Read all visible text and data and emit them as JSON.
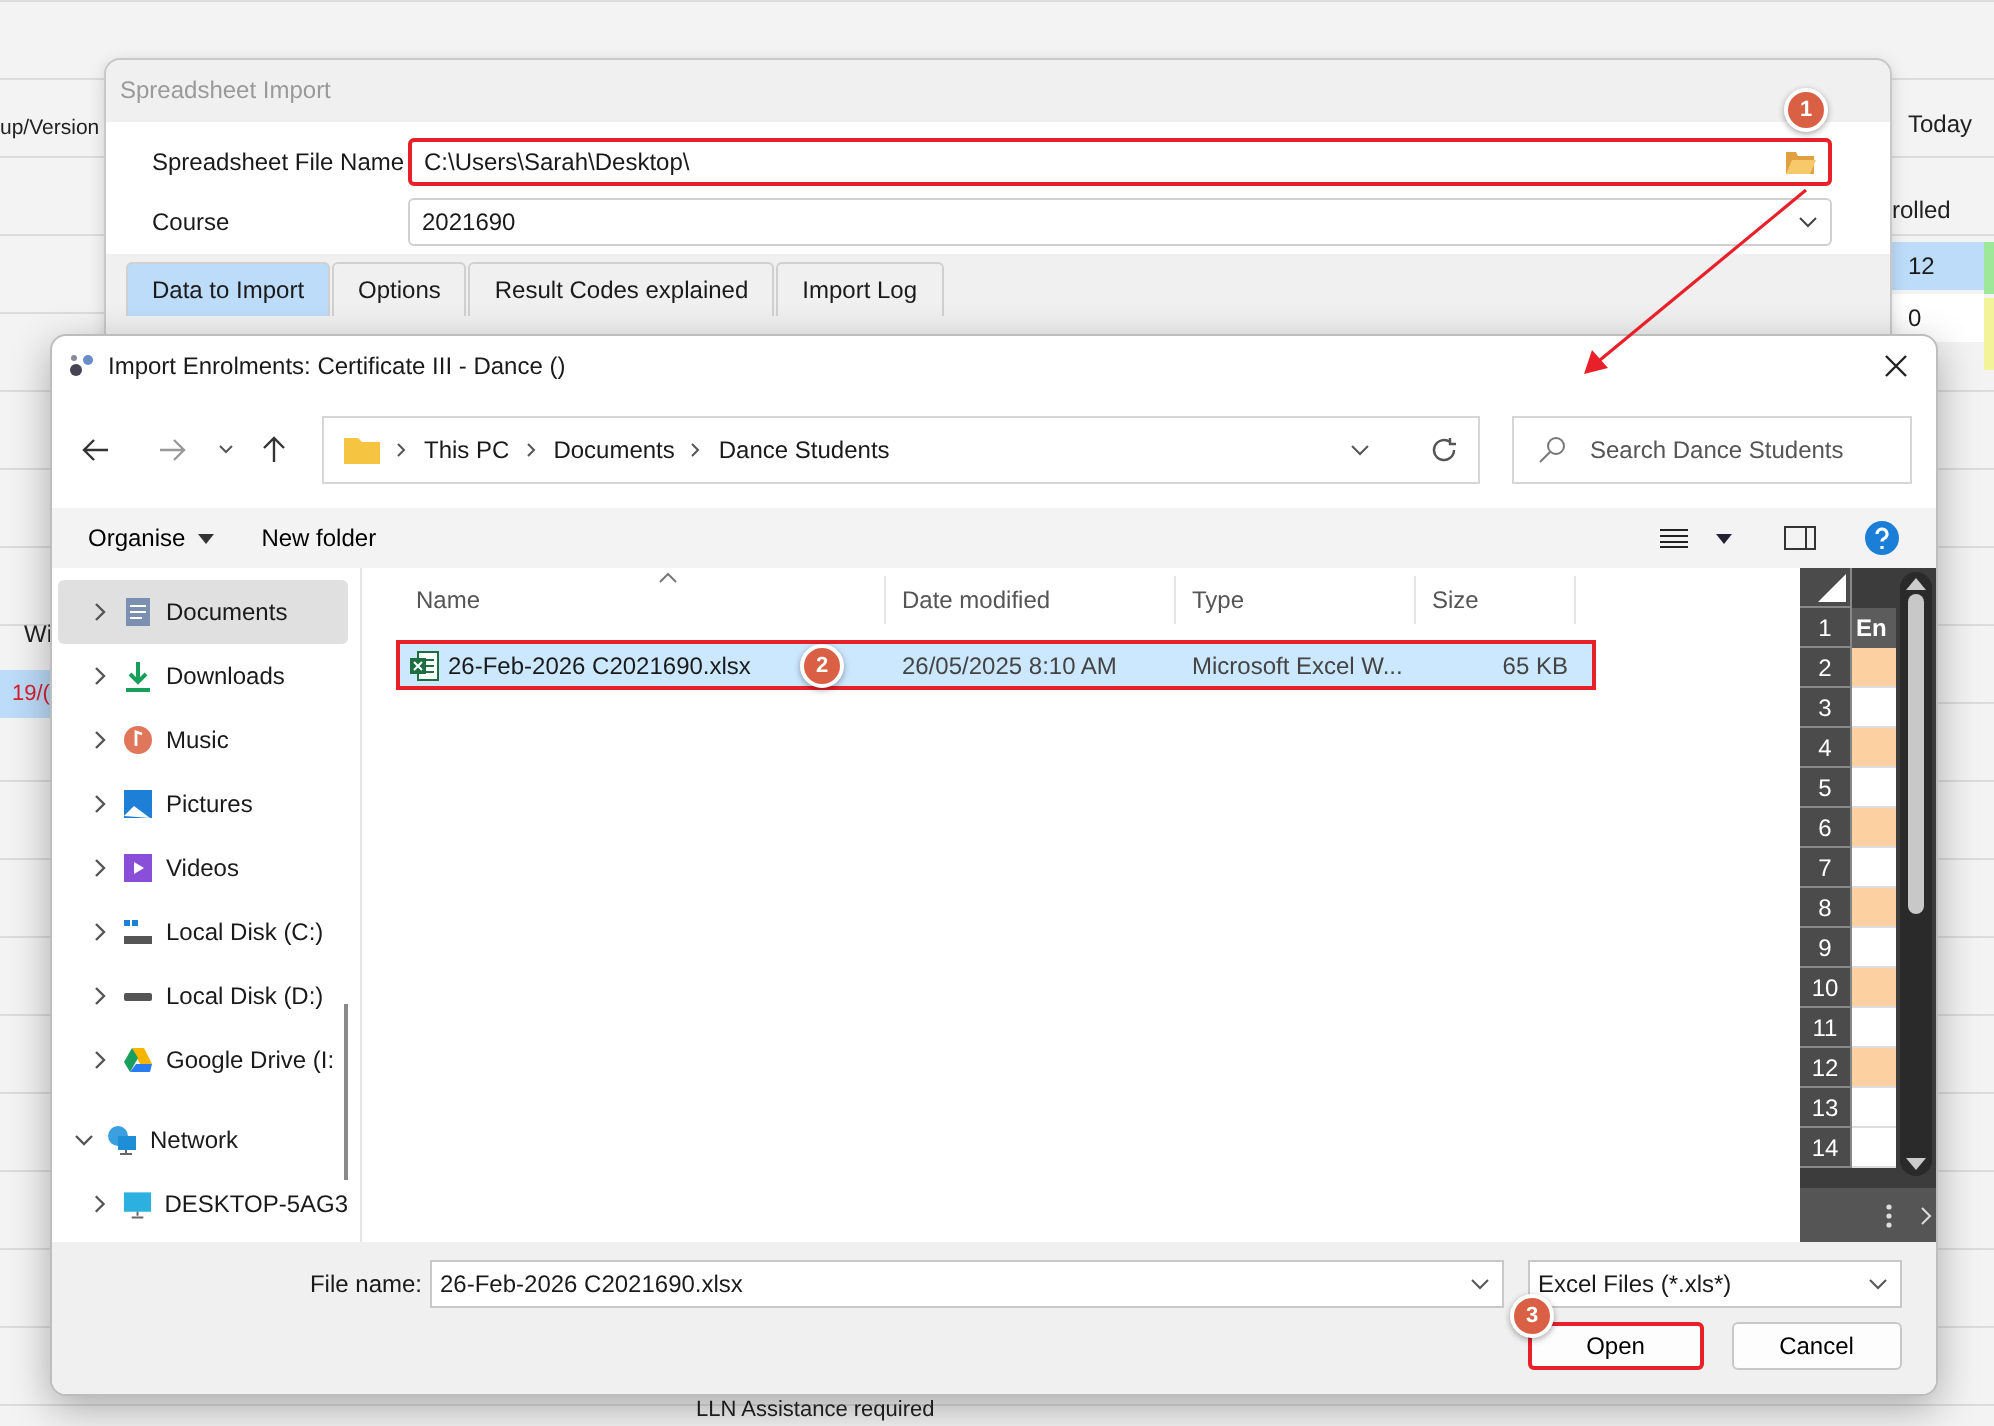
{
  "background_app": {
    "left_header": "up/Version",
    "right_header": "Today",
    "count_header": "rolled",
    "count_cells": [
      {
        "value": "12",
        "selected": true
      },
      {
        "value": "0",
        "selected": false
      }
    ],
    "side_header": "Wi",
    "side_cell": "19/(",
    "bottom_label": "LLN Assistance required"
  },
  "import_window": {
    "title": "Spreadsheet Import",
    "fields": [
      {
        "kind": "file",
        "label": "Spreadsheet File Name",
        "value": "C:\\Users\\Sarah\\Desktop\\",
        "highlighted": true,
        "badge": "1"
      },
      {
        "kind": "dropdown",
        "label": "Course",
        "value": "2021690",
        "highlighted": false
      }
    ],
    "tabs": [
      {
        "label": "Data to Import",
        "selected": true
      },
      {
        "label": "Options",
        "selected": false
      },
      {
        "label": "Result Codes explained",
        "selected": false
      },
      {
        "label": "Import Log",
        "selected": false
      }
    ]
  },
  "dialog": {
    "title": "Import Enrolments: Certificate III - Dance ()",
    "breadcrumb": [
      "This PC",
      "Documents",
      "Dance Students"
    ],
    "search": {
      "placeholder": "Search Dance Students"
    },
    "toolbar": {
      "organise": "Organise",
      "new_folder": "New folder"
    },
    "nav": [
      {
        "kind": "documents",
        "label": "Documents",
        "selected": true,
        "expanded": false
      },
      {
        "kind": "downloads",
        "label": "Downloads",
        "selected": false,
        "expanded": false
      },
      {
        "kind": "music",
        "label": "Music",
        "selected": false,
        "expanded": false
      },
      {
        "kind": "pictures",
        "label": "Pictures",
        "selected": false,
        "expanded": false
      },
      {
        "kind": "videos",
        "label": "Videos",
        "selected": false,
        "expanded": false
      },
      {
        "kind": "disk-c",
        "label": "Local Disk (C:)",
        "selected": false,
        "expanded": false
      },
      {
        "kind": "disk-d",
        "label": "Local Disk (D:)",
        "selected": false,
        "expanded": false
      },
      {
        "kind": "cloud-drive",
        "label": "Google Drive (I:",
        "selected": false,
        "expanded": false
      },
      {
        "kind": "network",
        "label": "Network",
        "selected": false,
        "expanded": true,
        "children": [
          {
            "kind": "computer",
            "label": "DESKTOP-5AG3",
            "selected": false,
            "expanded": false
          }
        ]
      }
    ],
    "columns": [
      "Name",
      "Date modified",
      "Type",
      "Size"
    ],
    "files": [
      {
        "name": "26-Feb-2026 C2021690.xlsx",
        "date": "26/05/2025 8:10 AM",
        "type": "Microsoft Excel W...",
        "size": "65 KB",
        "selected": true,
        "highlighted": true,
        "badge": "2"
      }
    ],
    "preview": {
      "header": "En",
      "rows": [
        {
          "number": "1",
          "highlighted": false
        },
        {
          "number": "2",
          "highlighted": true
        },
        {
          "number": "3",
          "highlighted": false
        },
        {
          "number": "4",
          "highlighted": true
        },
        {
          "number": "5",
          "highlighted": false
        },
        {
          "number": "6",
          "highlighted": true
        },
        {
          "number": "7",
          "highlighted": false
        },
        {
          "number": "8",
          "highlighted": true
        },
        {
          "number": "9",
          "highlighted": false
        },
        {
          "number": "10",
          "highlighted": true
        },
        {
          "number": "11",
          "highlighted": false
        },
        {
          "number": "12",
          "highlighted": true
        },
        {
          "number": "13",
          "highlighted": false
        },
        {
          "number": "14",
          "highlighted": false
        }
      ]
    },
    "file_name": {
      "label": "File name:",
      "value": "26-Feb-2026 C2021690.xlsx"
    },
    "file_type": "Excel Files (*.xls*)",
    "buttons": [
      {
        "label": "Open",
        "highlighted": true,
        "badge": "3"
      },
      {
        "label": "Cancel",
        "highlighted": false
      }
    ]
  }
}
